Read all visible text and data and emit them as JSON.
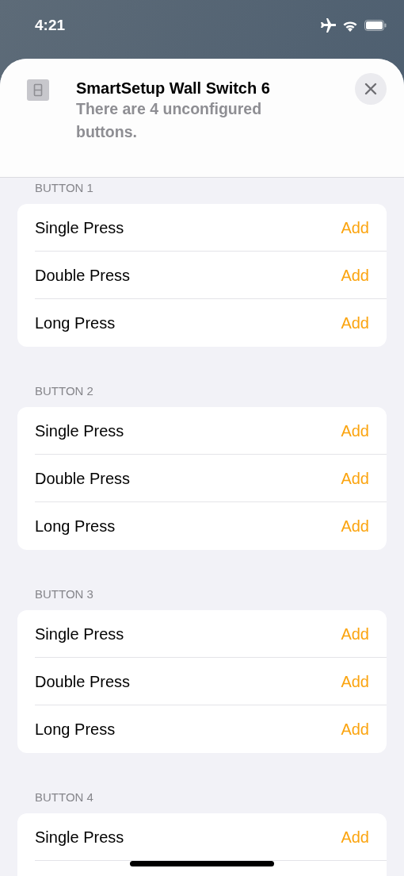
{
  "status_bar": {
    "time": "4:21"
  },
  "sheet": {
    "title": "SmartSetup Wall Switch 6",
    "subtitle": "There are 4 unconfigured buttons."
  },
  "sections": [
    {
      "title": "BUTTON 1",
      "rows": [
        {
          "label": "Single Press",
          "action": "Add"
        },
        {
          "label": "Double Press",
          "action": "Add"
        },
        {
          "label": "Long Press",
          "action": "Add"
        }
      ]
    },
    {
      "title": "BUTTON 2",
      "rows": [
        {
          "label": "Single Press",
          "action": "Add"
        },
        {
          "label": "Double Press",
          "action": "Add"
        },
        {
          "label": "Long Press",
          "action": "Add"
        }
      ]
    },
    {
      "title": "BUTTON 3",
      "rows": [
        {
          "label": "Single Press",
          "action": "Add"
        },
        {
          "label": "Double Press",
          "action": "Add"
        },
        {
          "label": "Long Press",
          "action": "Add"
        }
      ]
    },
    {
      "title": "BUTTON 4",
      "rows": [
        {
          "label": "Single Press",
          "action": "Add"
        }
      ]
    }
  ]
}
